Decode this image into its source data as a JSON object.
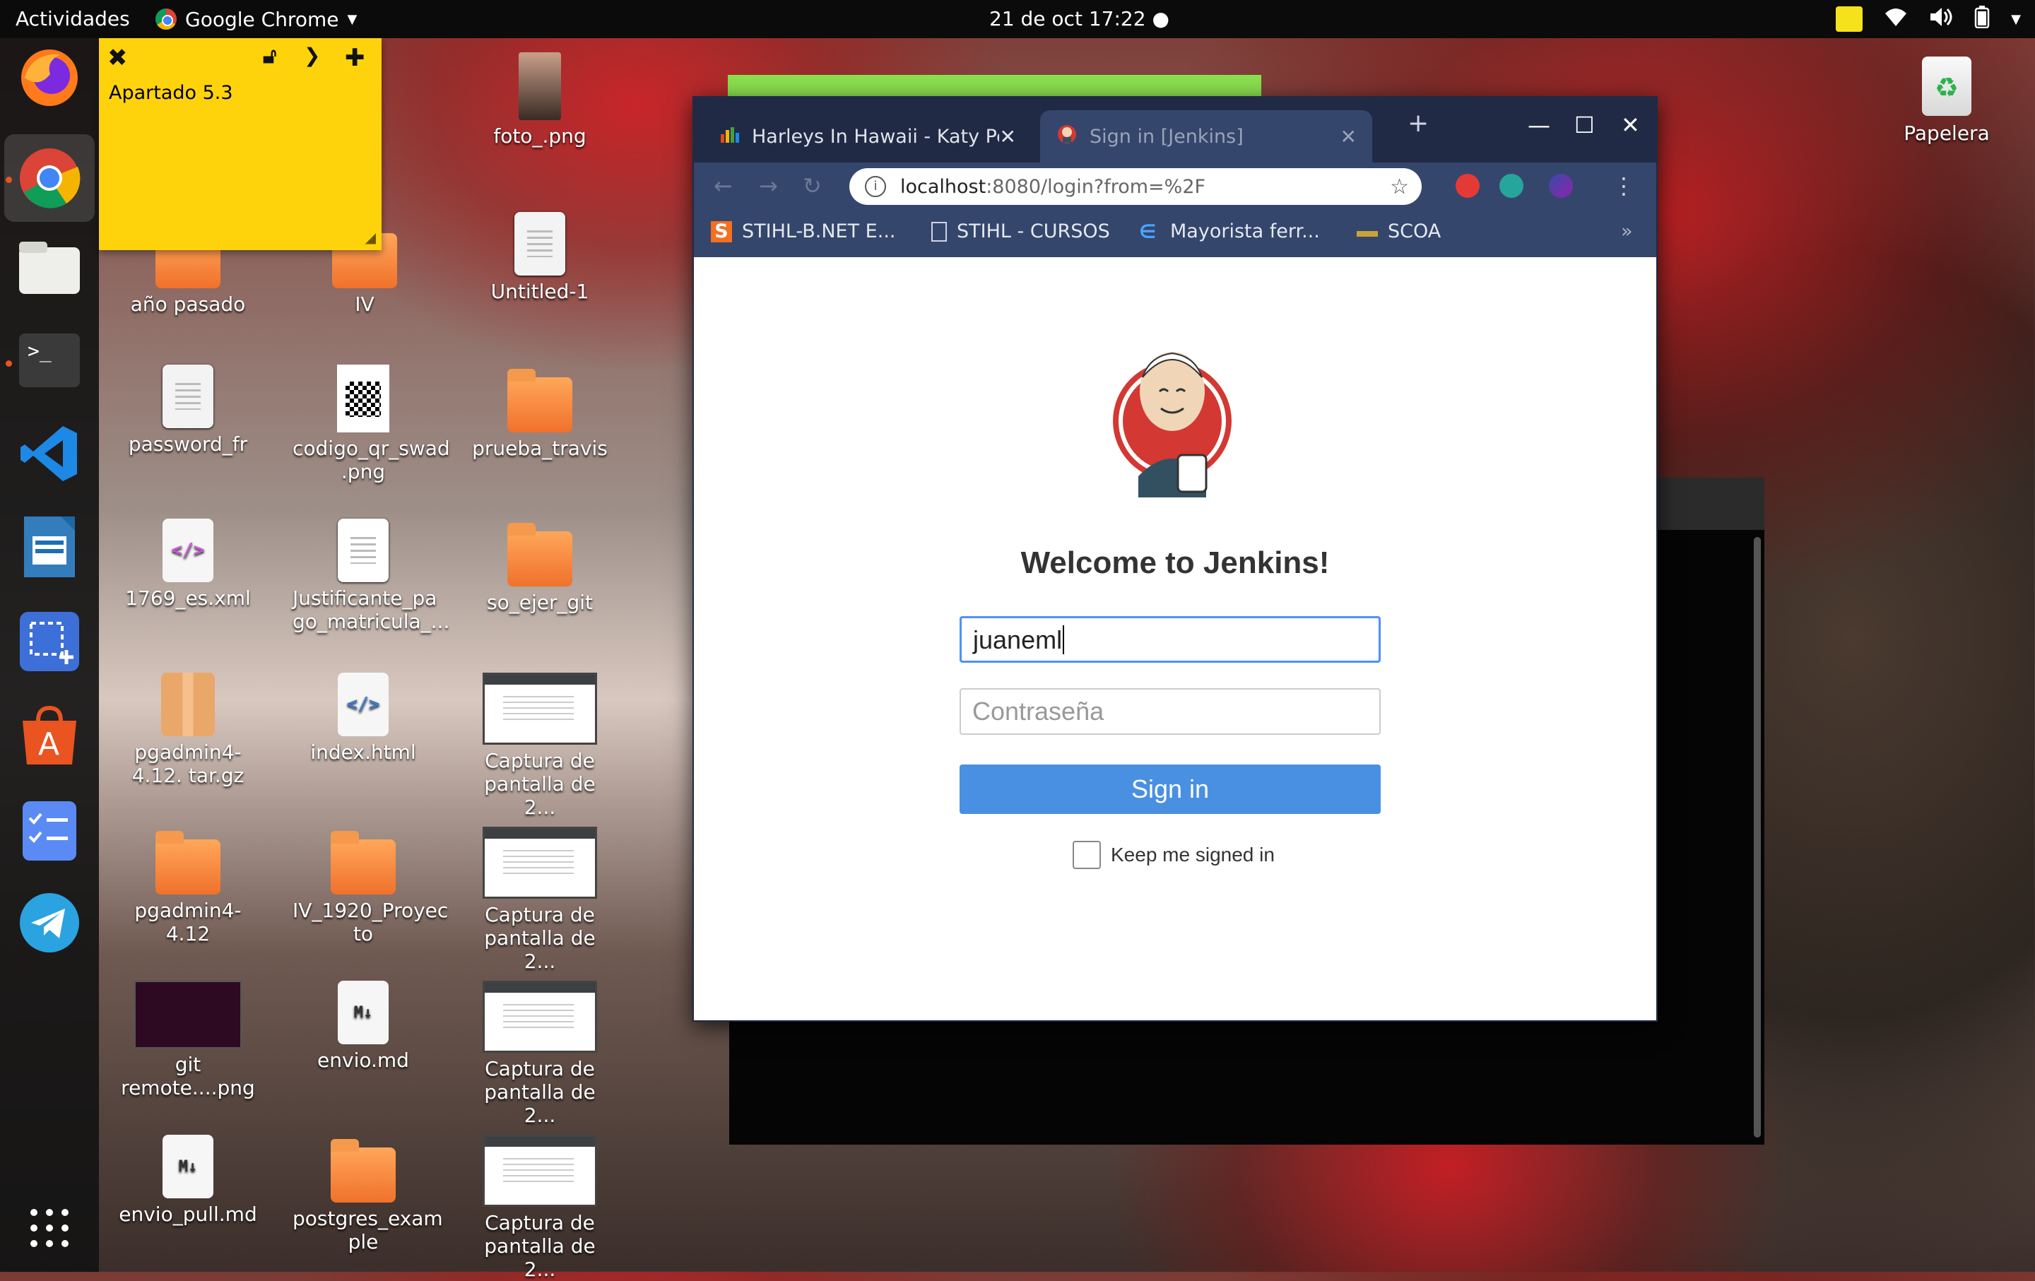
{
  "topbar": {
    "activities": "Actividades",
    "app_name": "Google Chrome",
    "datetime": "21 de oct  17:22"
  },
  "dock": {
    "apps": [
      "firefox-icon",
      "chrome-icon",
      "files-icon",
      "terminal-icon",
      "vscode-icon",
      "writer-icon",
      "screenshot-icon",
      "software-icon",
      "todo-icon",
      "telegram-icon",
      "show-apps-icon"
    ]
  },
  "sticky_note": {
    "title": "Apartado 5.3"
  },
  "desktop": {
    "icons": [
      {
        "label": "año pasado"
      },
      {
        "label": "IV"
      },
      {
        "label": "Untitled-1"
      },
      {
        "label": "foto_.png"
      },
      {
        "label": "password_fr"
      },
      {
        "label": "codigo_qr_swad .png"
      },
      {
        "label": "prueba_travis"
      },
      {
        "label": "1769_es.xml"
      },
      {
        "label": "Justificante_pa go_matricula_..."
      },
      {
        "label": "so_ejer_git"
      },
      {
        "label": "pgadmin4-4.12. tar.gz"
      },
      {
        "label": "index.html"
      },
      {
        "label": "Captura de pantalla de 2..."
      },
      {
        "label": "pgadmin4-4.12"
      },
      {
        "label": "IV_1920_Proyec to"
      },
      {
        "label": "Captura de pantalla de 2..."
      },
      {
        "label": "git remote....png"
      },
      {
        "label": "envio.md"
      },
      {
        "label": "Captura de pantalla de 2..."
      },
      {
        "label": "envio_pull.md"
      },
      {
        "label": "postgres_exam ple"
      },
      {
        "label": "Captura de pantalla de 2..."
      }
    ],
    "trash": "Papelera"
  },
  "browser": {
    "tabs": [
      {
        "title": "Harleys In Hawaii - Katy Pe"
      },
      {
        "title": "Sign in [Jenkins]"
      }
    ],
    "url_host": "localhost",
    "url_path": ":8080/login?from=%2F",
    "bookmarks": [
      "STIHL-B.NET E...",
      "STIHL - CURSOS",
      "Mayorista ferr...",
      "SCOA"
    ],
    "bookmarks_more": "»"
  },
  "jenkins": {
    "welcome": "Welcome to Jenkins!",
    "username_value": "juaneml",
    "password_placeholder": "Contraseña",
    "signin_label": "Sign in",
    "keep_signed_label": "Keep me signed in"
  }
}
